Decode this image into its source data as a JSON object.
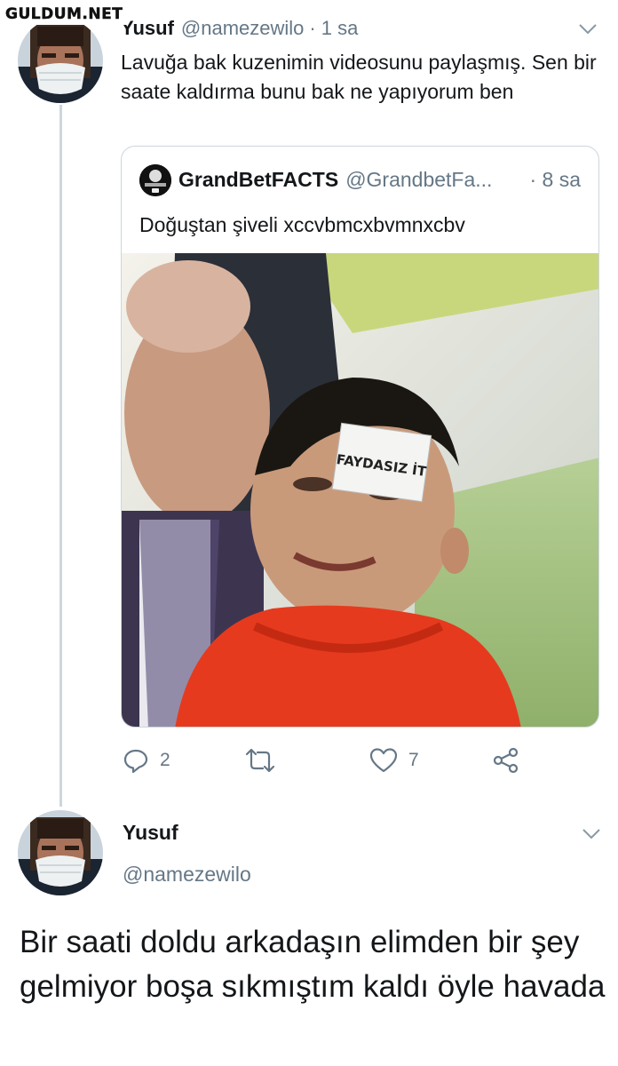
{
  "watermark": "GULDUM.NET",
  "tweet": {
    "author_name": "Yusuf",
    "author_handle": "@namezewilo",
    "separator": "·",
    "time": "1 sa",
    "text": "Lavuğa bak kuzenimin videosunu paylaşmış. Sen bir saate kaldırma bunu bak ne yapıyorum ben",
    "quoted": {
      "author_name": "GrandBetFACTS",
      "author_handle": "@GrandbetFa...",
      "time": "· 8 sa",
      "text": "Doğuştan şiveli xccvbmcxbvmnxcbv",
      "media_sticker_text": "FAYDASIZ İT"
    },
    "actions": {
      "reply_count": "2",
      "retweet_count": "",
      "like_count": "7"
    }
  },
  "reply": {
    "author_name": "Yusuf",
    "author_handle": "@namezewilo",
    "text": "Bir saati doldu arkadaşın elimden bir şey gelmiyor boşa sıkmıştım kaldı öyle havada"
  },
  "icons": {
    "reply": "reply-icon",
    "retweet": "retweet-icon",
    "like": "heart-icon",
    "share": "share-icon",
    "menu": "chevron-down-icon"
  },
  "colors": {
    "text_primary": "#14171a",
    "text_secondary": "#657786",
    "border": "#ccd6dd"
  }
}
